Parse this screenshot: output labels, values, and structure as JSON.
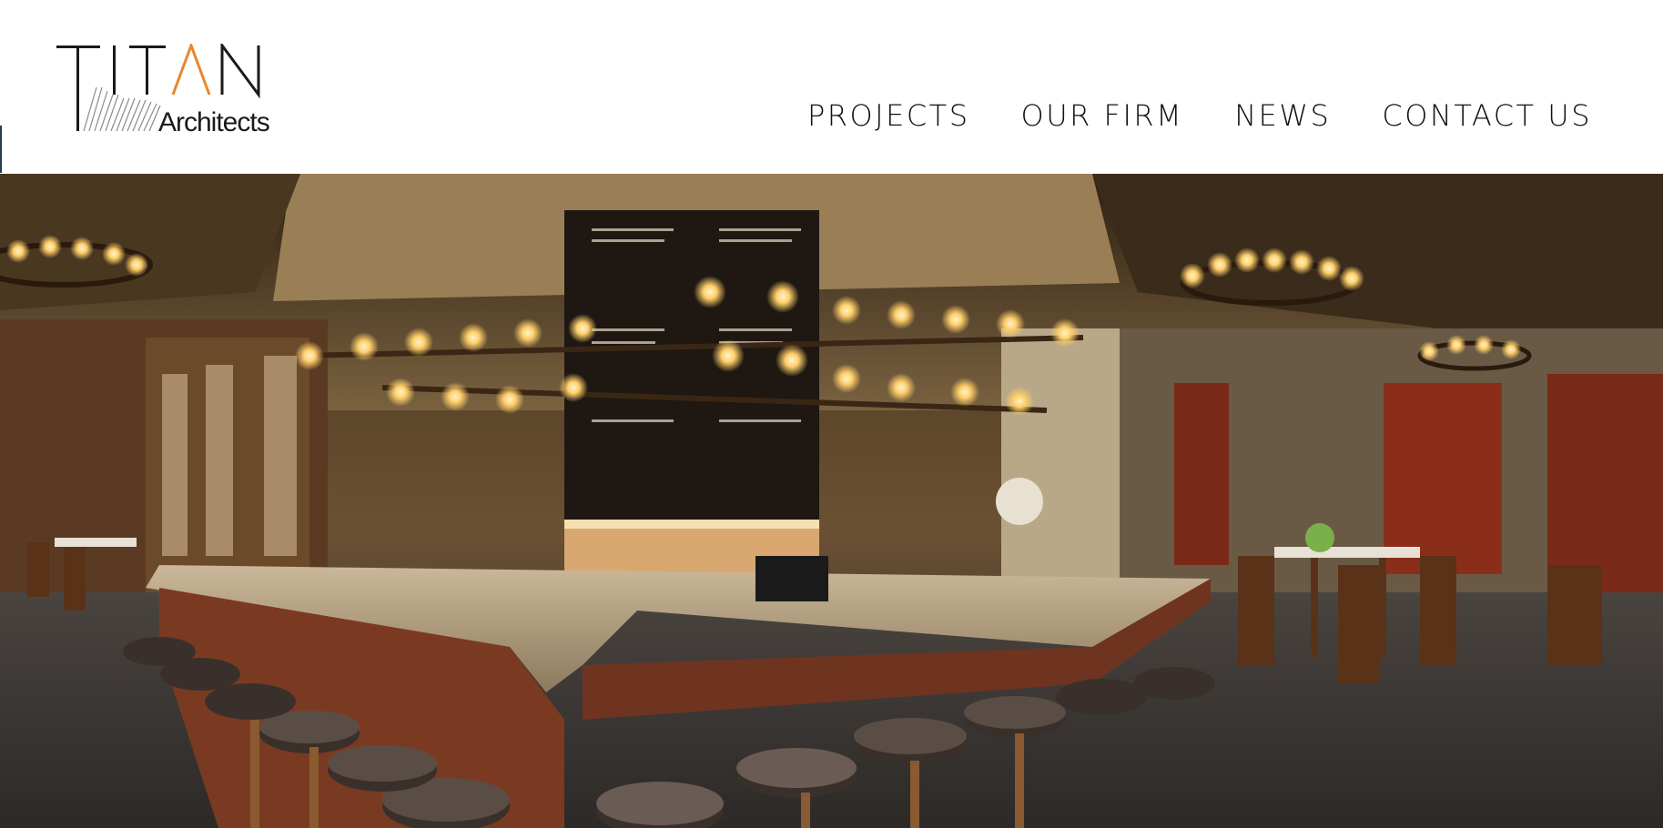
{
  "brand": {
    "name": "TITAN",
    "subtitle": "Architects",
    "accent_color": "#e8872a",
    "text_color": "#1a1a1a"
  },
  "nav": {
    "items": [
      {
        "label": "PROJECTS"
      },
      {
        "label": "OUR FIRM"
      },
      {
        "label": "NEWS"
      },
      {
        "label": "CONTACT US"
      }
    ]
  },
  "hero": {
    "image_description_icon": "restaurant-bar-interior-photo"
  }
}
